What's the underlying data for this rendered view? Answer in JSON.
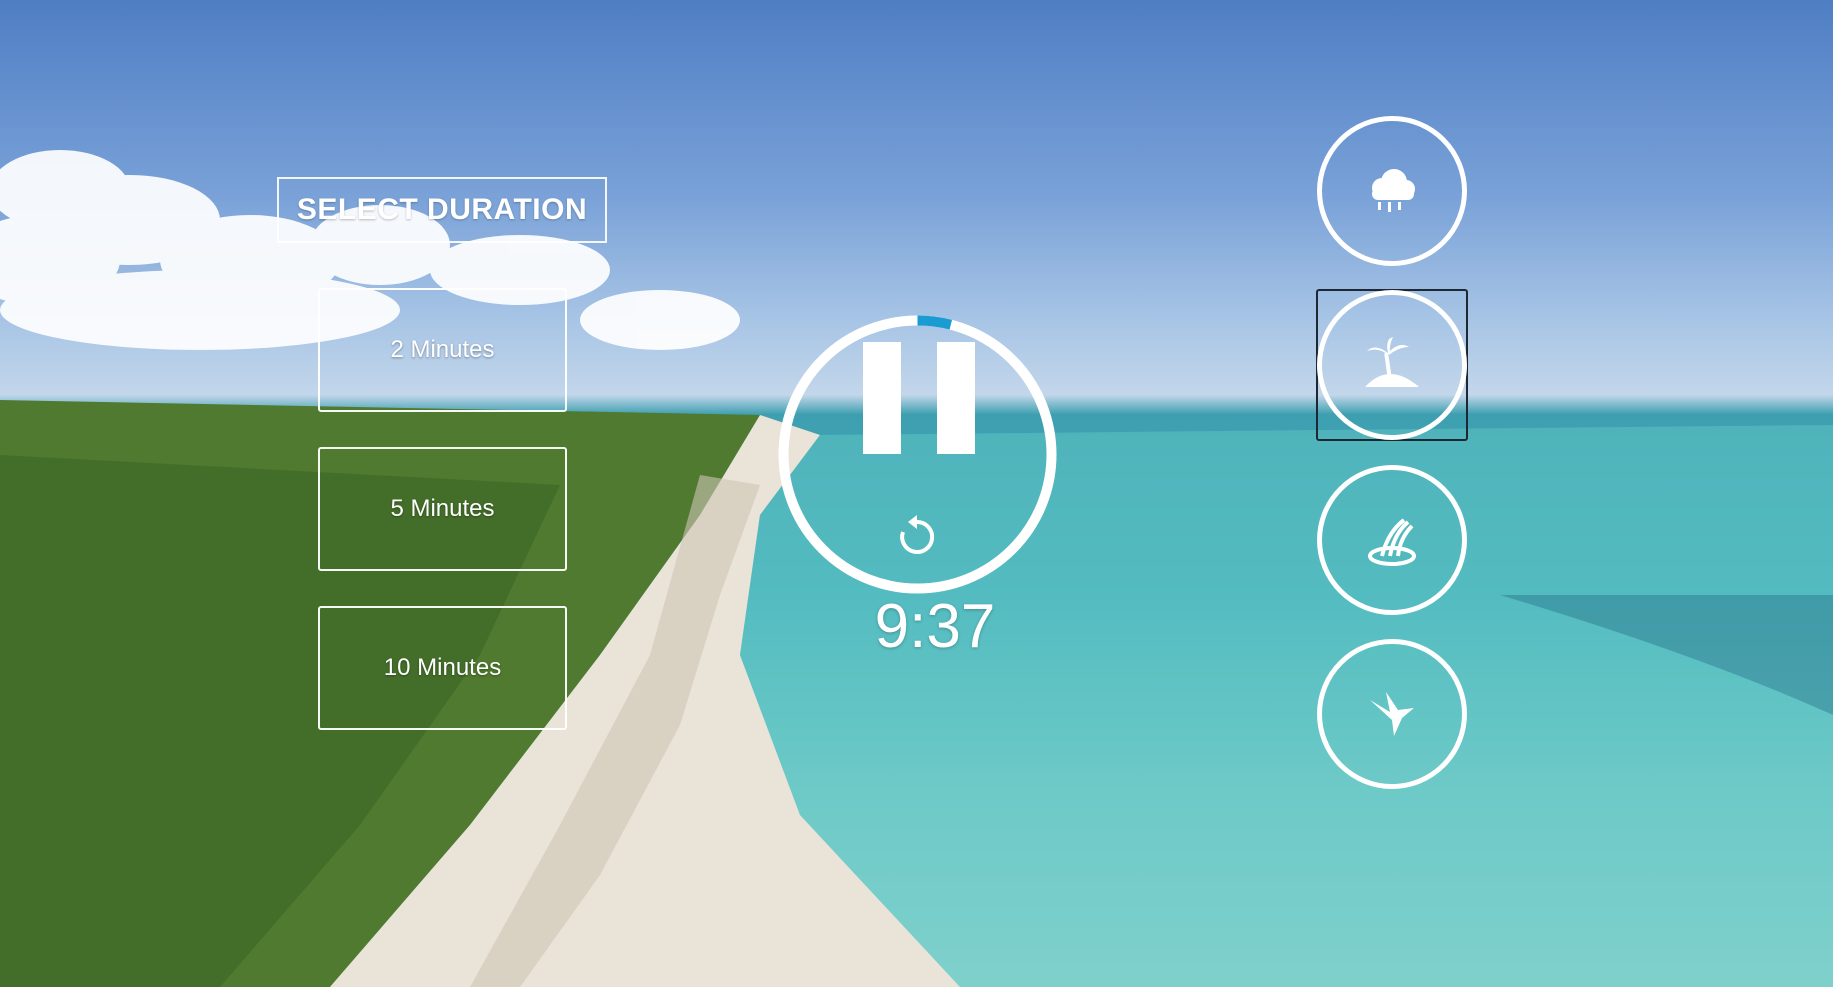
{
  "duration_panel": {
    "title": "SELECT DURATION",
    "options": [
      "2 Minutes",
      "5 Minutes",
      "10 Minutes"
    ]
  },
  "timer": {
    "time_display": "9:37",
    "progress_fraction": 0.04,
    "progress_color": "#1a9bd1",
    "state": "playing"
  },
  "scenes": [
    {
      "name": "rain",
      "icon": "rain-cloud-icon",
      "selected": false
    },
    {
      "name": "island",
      "icon": "palm-island-icon",
      "selected": true
    },
    {
      "name": "waterfall",
      "icon": "waterfall-icon",
      "selected": false
    },
    {
      "name": "bird",
      "icon": "bird-icon",
      "selected": false
    }
  ]
}
